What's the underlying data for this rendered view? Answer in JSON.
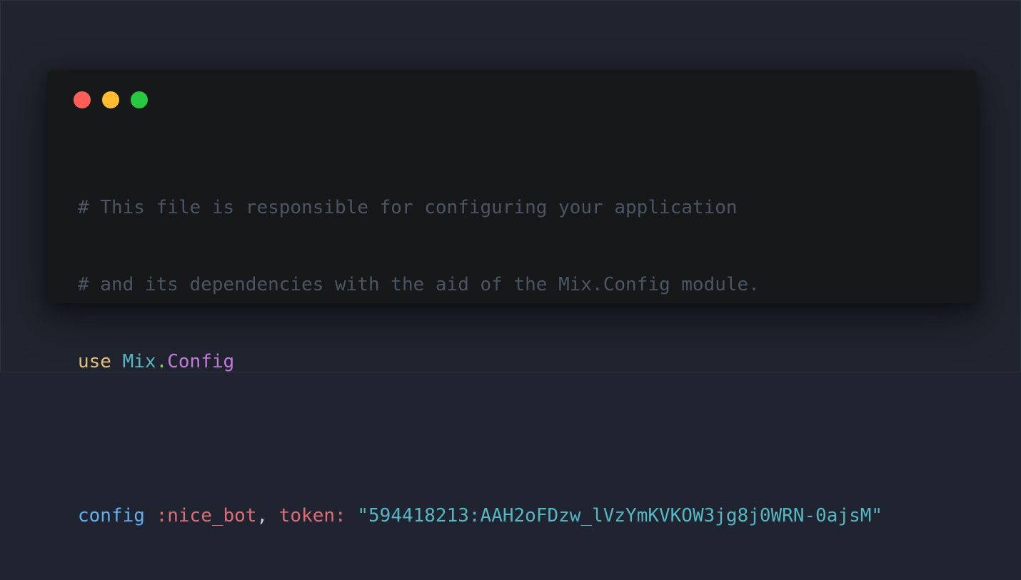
{
  "colors": {
    "background": "#1f2430",
    "window": "#171819",
    "close": "#ff5f57",
    "minimize": "#febc2e",
    "maximize": "#28c840",
    "comment": "#4b5563",
    "keyword": "#e5c07b",
    "module": "#56b6c2",
    "dot": "#98c379",
    "module_alt": "#c678dd",
    "function": "#61afef",
    "atom": "#e06c75",
    "punct": "#c9ccd1",
    "string": "#56b6c2"
  },
  "window_controls": [
    "close-icon",
    "minimize-icon",
    "maximize-icon"
  ],
  "code": {
    "line1": "# This file is responsible for configuring your application",
    "line2": "# and its dependencies with the aid of the Mix.Config module.",
    "line3": {
      "keyword": "use",
      "module": "Mix",
      "dot": ".",
      "module2": "Config"
    },
    "line5": {
      "function": "config",
      "atom": ":nice_bot",
      "comma": ",",
      "key": "token:",
      "string": "\"594418213:AAH2oFDzw_lVzYmKVKOW3jg8j0WRN-0ajsM\""
    }
  }
}
